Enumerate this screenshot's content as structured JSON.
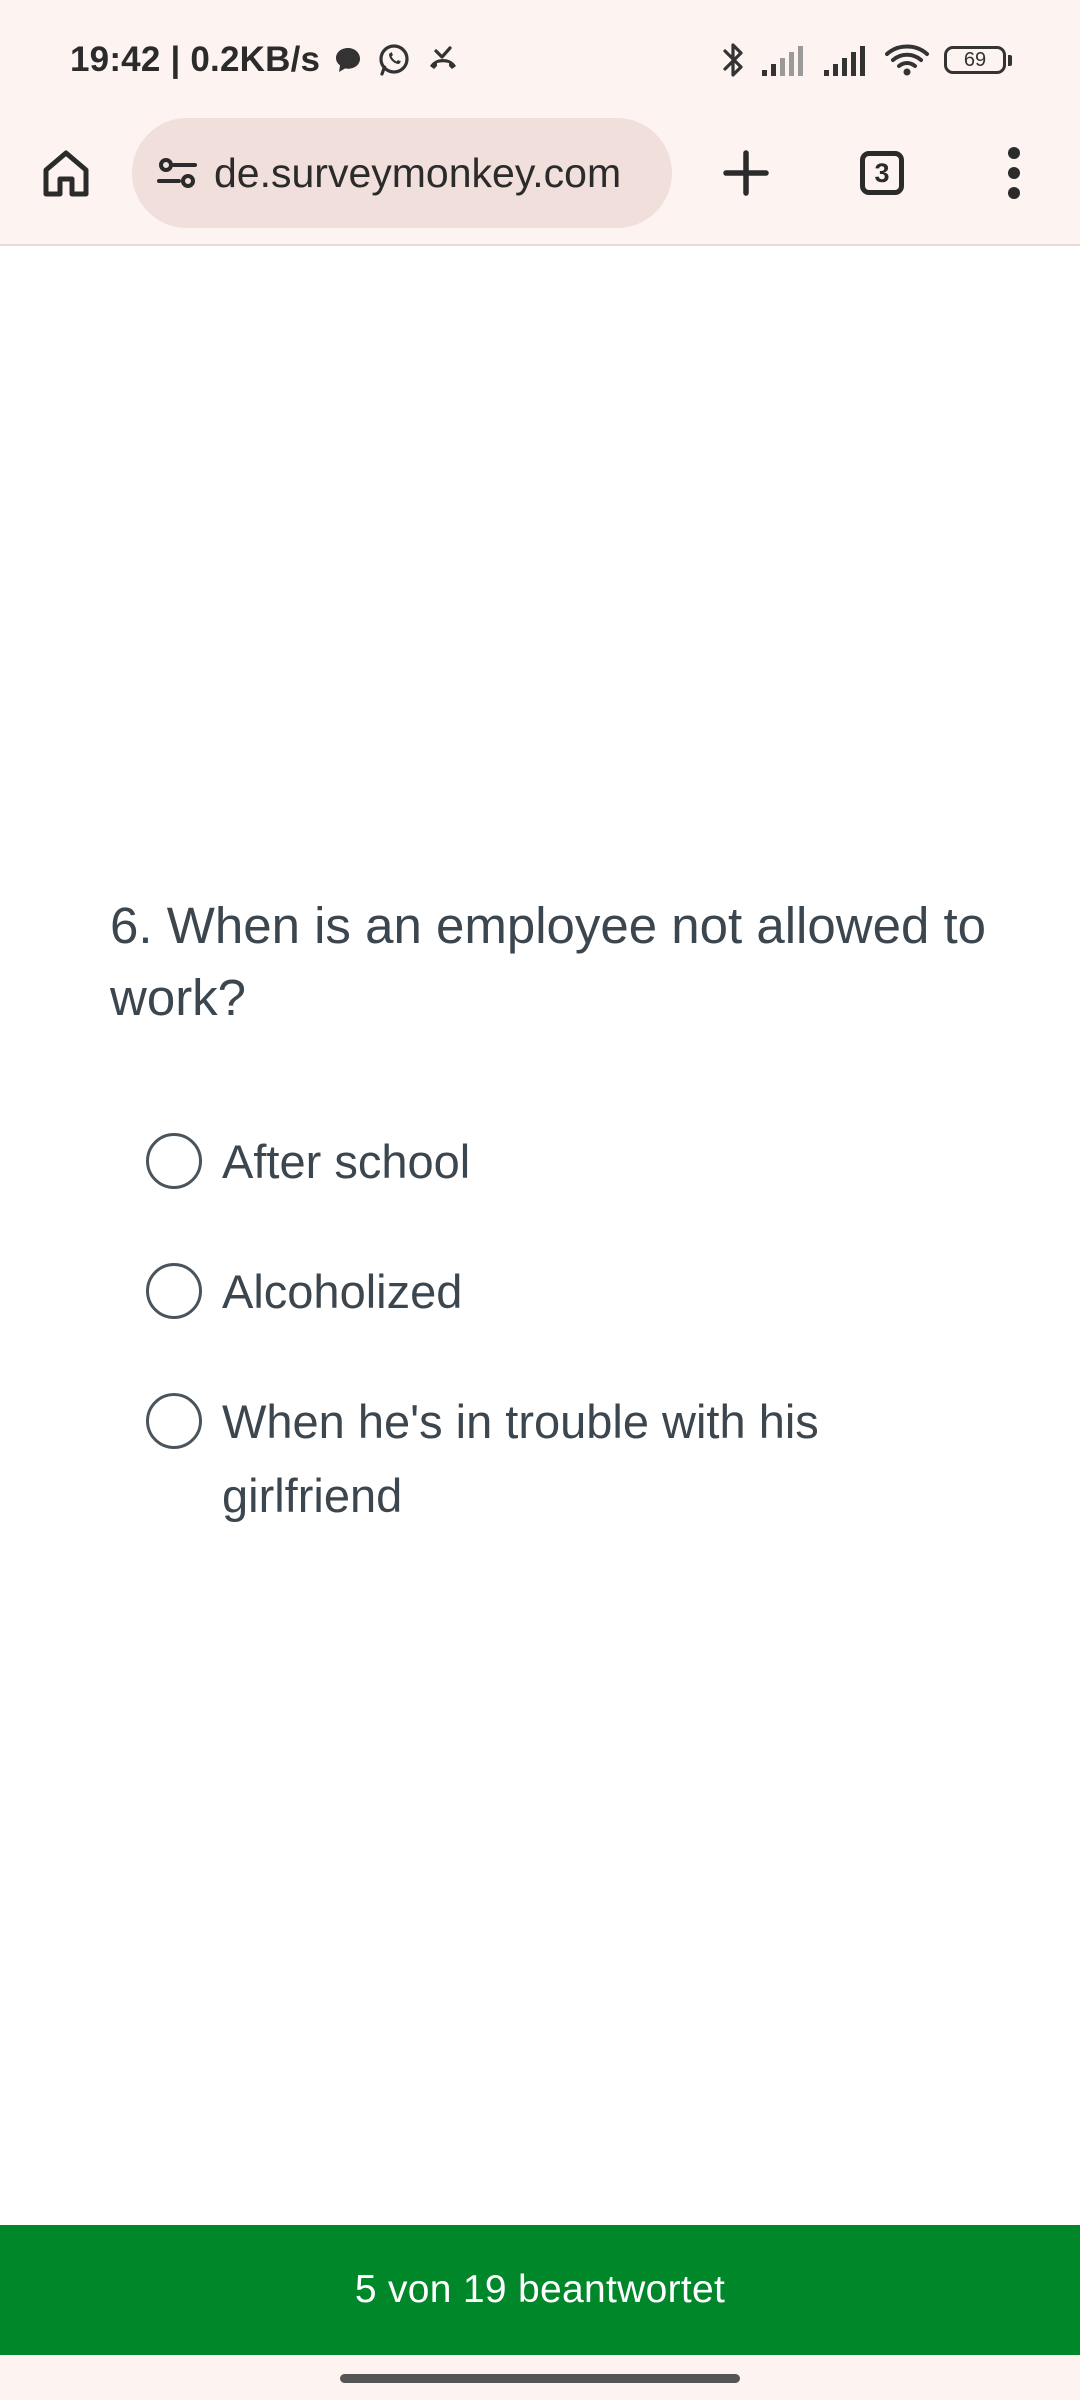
{
  "status_bar": {
    "time": "19:42 | 0.2KB/s",
    "battery": "69",
    "icons": [
      "chat-bubble-icon",
      "whatsapp-icon",
      "missed-call-icon",
      "bluetooth-icon",
      "signal-icon",
      "signal-icon",
      "wifi-icon",
      "battery-icon"
    ]
  },
  "browser": {
    "url": "de.surveymonkey.com",
    "tab_count": "3",
    "icons": [
      "home-icon",
      "site-settings-icon",
      "plus-icon",
      "tab-switcher-icon",
      "more-vert-icon"
    ]
  },
  "survey": {
    "question": "6. When is an employee not allowed to work?",
    "options": [
      {
        "label": "After school"
      },
      {
        "label": "Alcoholized"
      },
      {
        "label": "When he's in trouble with his girlfriend"
      }
    ]
  },
  "footer": {
    "progress_text": "5 von 19 beantwortet",
    "progress_answered": 5,
    "progress_total": 19
  },
  "colors": {
    "browser_chrome": "#fdf4f2",
    "url_bar": "#f0dfdb",
    "footer_green": "#00872a",
    "text": "#3c464f"
  }
}
